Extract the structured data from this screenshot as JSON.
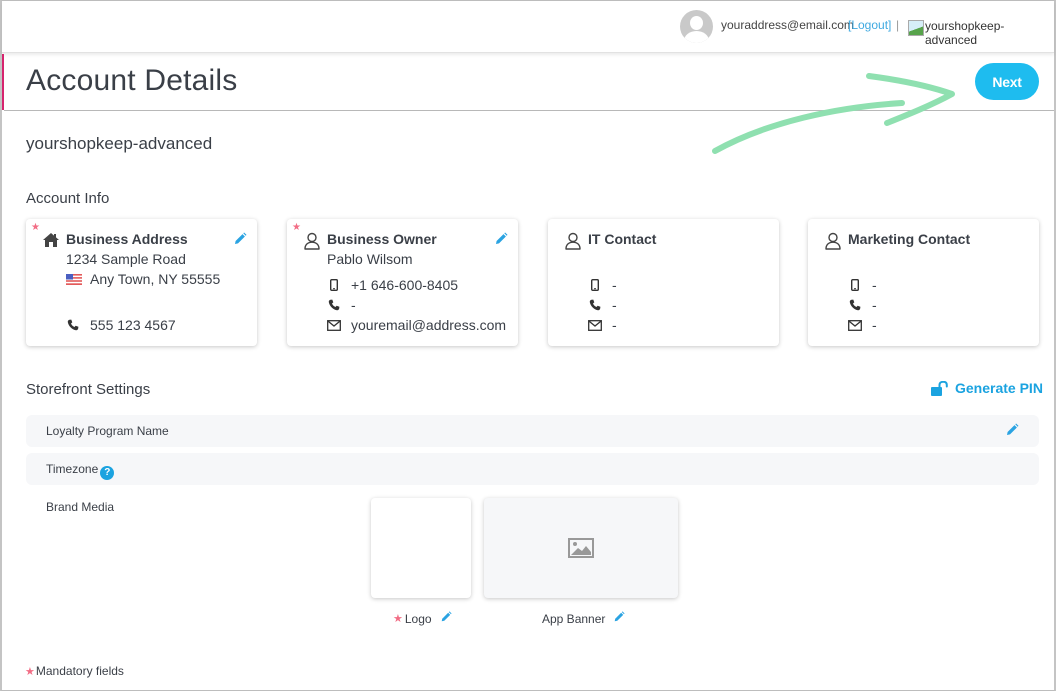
{
  "topbar": {
    "user_email": "youraddress@email.com",
    "logout_label": "[Logout]",
    "separator": "|",
    "shop_name": "yourshopkeep-advanced"
  },
  "header": {
    "title": "Account Details",
    "next_label": "Next"
  },
  "shop_subtitle": "yourshopkeep-advanced",
  "account_info": {
    "section_title": "Account Info",
    "cards": [
      {
        "title": "Business Address",
        "icon": "home-icon",
        "required": true,
        "editable": true,
        "address_line1": "1234 Sample Road",
        "address_line2": "Any Town, NY 55555",
        "country_flag": "us-flag-icon",
        "phone": "555 123 4567"
      },
      {
        "title": "Business Owner",
        "icon": "user-icon",
        "required": true,
        "editable": true,
        "name": "Pablo Wilsom",
        "mobile": "+1 646-600-8405",
        "phone": "-",
        "email": "youremail@address.com"
      },
      {
        "title": "IT Contact",
        "icon": "user-icon",
        "required": false,
        "editable": false,
        "mobile": "-",
        "phone": "-",
        "email": "-"
      },
      {
        "title": "Marketing Contact",
        "icon": "user-icon",
        "required": false,
        "editable": false,
        "mobile": "-",
        "phone": "-",
        "email": "-"
      }
    ]
  },
  "storefront": {
    "section_title": "Storefront Settings",
    "generate_pin_label": "Generate PIN",
    "rows": [
      {
        "label": "Loyalty Program Name",
        "editable": true
      },
      {
        "label": "Timezone",
        "help": "?"
      }
    ],
    "brand_media": {
      "label": "Brand Media",
      "logo_caption": "Logo",
      "banner_caption": "App Banner"
    }
  },
  "footer": {
    "mandatory_note": "Mandatory fields",
    "star": "★"
  },
  "colors": {
    "accent_blue": "#1ebcef",
    "link_blue": "#1ba3e0",
    "required_star": "#f26d85",
    "accent_pink": "#d6246e",
    "annotation_arrow": "#8fe0b0"
  }
}
